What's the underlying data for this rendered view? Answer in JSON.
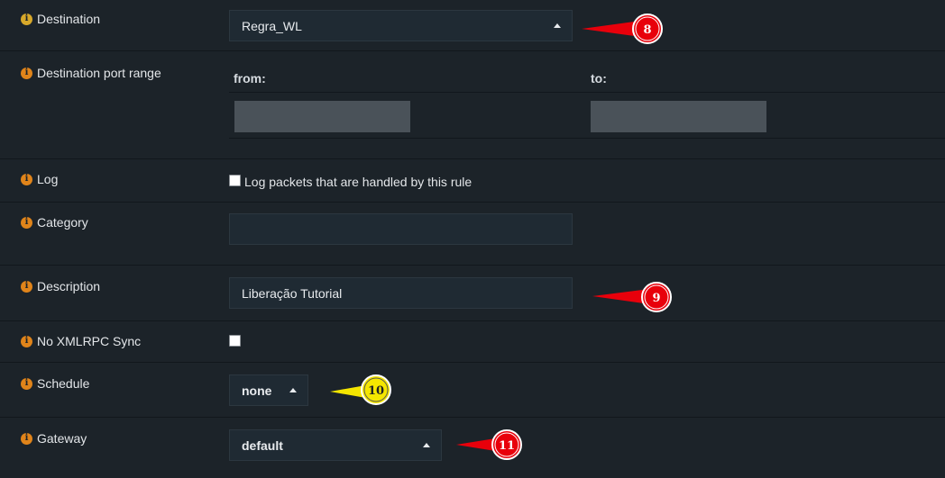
{
  "rows": {
    "destination": {
      "label": "Destination",
      "value": "Regra_WL"
    },
    "port_range": {
      "label": "Destination port range",
      "from_label": "from:",
      "to_label": "to:",
      "from_value": "",
      "to_value": ""
    },
    "log": {
      "label": "Log",
      "checkbox_label": "Log packets that are handled by this rule",
      "checked": false
    },
    "category": {
      "label": "Category",
      "value": ""
    },
    "description": {
      "label": "Description",
      "value": "Liberação Tutorial"
    },
    "no_xmlrpc": {
      "label": "No XMLRPC Sync",
      "checked": false
    },
    "schedule": {
      "label": "Schedule",
      "value": "none"
    },
    "gateway": {
      "label": "Gateway",
      "value": "default"
    }
  },
  "annotations": [
    {
      "number": "8",
      "color": "#e8000b"
    },
    {
      "number": "9",
      "color": "#e8000b"
    },
    {
      "number": "10",
      "color": "#f5e600"
    },
    {
      "number": "11",
      "color": "#e8000b"
    }
  ],
  "icons": {
    "info": "info-icon",
    "caret": "caret-up-icon",
    "pointer": "arrow-pointer-icon"
  },
  "colors": {
    "background": "#1c2329",
    "info_icon": "#e0841a",
    "callout_red": "#e8000b",
    "callout_yellow": "#f5e600"
  }
}
